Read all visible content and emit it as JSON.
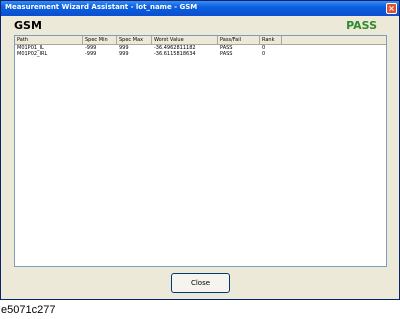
{
  "window": {
    "title": "Measurement Wizard Assistant - lot_name - GSM",
    "close_glyph": "×"
  },
  "header": {
    "name": "GSM",
    "status": "PASS",
    "status_color": "#2e8b2e"
  },
  "table": {
    "columns": [
      "Path",
      "Spec Min",
      "Spec Max",
      "Worst Value",
      "Pass/Fail",
      "Rank"
    ],
    "rows": [
      [
        "M01P01_IL",
        "-999",
        "999",
        "-36.4962811182",
        "PASS",
        "0"
      ],
      [
        "M01P02_IRL",
        "-999",
        "999",
        "-36.6115818634",
        "PASS",
        "0"
      ]
    ]
  },
  "footer": {
    "close_label": "Close"
  },
  "caption": "e5071c277"
}
